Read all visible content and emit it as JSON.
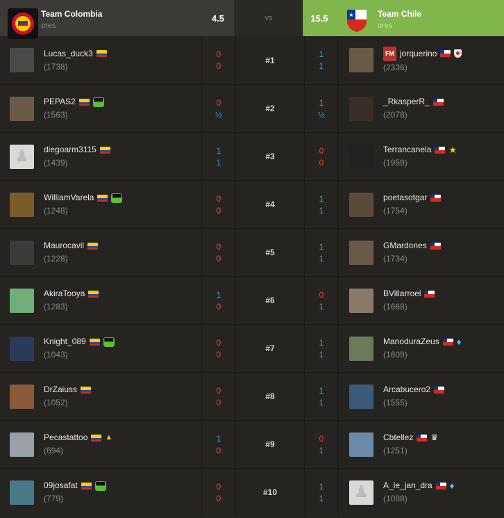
{
  "header": {
    "left_team": "Team Colombia",
    "left_sub": "ores",
    "left_score": "4.5",
    "vs_label": "vs",
    "right_score": "15.5",
    "right_team": "Team Chile",
    "right_sub": "ores"
  },
  "colors": {
    "background": "#262421",
    "header_dark": "#3c3a37",
    "header_win": "#81b64c",
    "score_win": "#3e9bd6",
    "score_loss": "#e0463b"
  },
  "rows": [
    {
      "board": "#1",
      "left": {
        "name": "Lucas_duck3",
        "rating": "(1738)",
        "badges": []
      },
      "ls": [
        "0",
        "0"
      ],
      "rs": [
        "1",
        "1"
      ],
      "right": {
        "name": "jorquerino",
        "rating": "(2336)",
        "title": "FM",
        "badges": [
          "shield-icon"
        ]
      }
    },
    {
      "board": "#2",
      "left": {
        "name": "PEPAS2",
        "rating": "(1563)",
        "badges": [
          "glasses-icon"
        ]
      },
      "ls": [
        "0",
        "½"
      ],
      "rs": [
        "1",
        "½"
      ],
      "right": {
        "name": "_RkasperR_",
        "rating": "(2078)",
        "badges": []
      }
    },
    {
      "board": "#3",
      "left": {
        "name": "diegoarm3115",
        "rating": "(1439)",
        "badges": []
      },
      "ls": [
        "1",
        "1"
      ],
      "rs": [
        "0",
        "0"
      ],
      "right": {
        "name": "Terrancanela",
        "rating": "(1959)",
        "badges": [
          "star-icon"
        ]
      }
    },
    {
      "board": "#4",
      "left": {
        "name": "WilliamVarela",
        "rating": "(1248)",
        "badges": [
          "glasses-icon"
        ]
      },
      "ls": [
        "0",
        "0"
      ],
      "rs": [
        "1",
        "1"
      ],
      "right": {
        "name": "poetasotgar",
        "rating": "(1754)",
        "badges": []
      }
    },
    {
      "board": "#5",
      "left": {
        "name": "Maurocavil",
        "rating": "(1228)",
        "badges": []
      },
      "ls": [
        "0",
        "0"
      ],
      "rs": [
        "1",
        "1"
      ],
      "right": {
        "name": "GMardones",
        "rating": "(1734)",
        "badges": []
      }
    },
    {
      "board": "#6",
      "left": {
        "name": "AkiraTooya",
        "rating": "(1283)",
        "badges": []
      },
      "ls": [
        "1",
        "0"
      ],
      "rs": [
        "0",
        "1"
      ],
      "right": {
        "name": "BVillarroel",
        "rating": "(1668)",
        "badges": []
      }
    },
    {
      "board": "#7",
      "left": {
        "name": "Knight_089",
        "rating": "(1043)",
        "badges": [
          "glasses-icon"
        ]
      },
      "ls": [
        "0",
        "0"
      ],
      "rs": [
        "1",
        "1"
      ],
      "right": {
        "name": "ManoduraZeus",
        "rating": "(1609)",
        "badges": [
          "diamond-icon"
        ]
      }
    },
    {
      "board": "#8",
      "left": {
        "name": "DrZaiuss",
        "rating": "(1052)",
        "badges": []
      },
      "ls": [
        "0",
        "0"
      ],
      "rs": [
        "1",
        "1"
      ],
      "right": {
        "name": "Arcabucero2",
        "rating": "(1555)",
        "badges": []
      }
    },
    {
      "board": "#9",
      "left": {
        "name": "Pecastattoo",
        "rating": "(694)",
        "badges": [
          "flame-icon"
        ]
      },
      "ls": [
        "1",
        "0"
      ],
      "rs": [
        "0",
        "1"
      ],
      "right": {
        "name": "Cbtellez",
        "rating": "(1251)",
        "badges": [
          "crown-icon"
        ]
      }
    },
    {
      "board": "#10",
      "left": {
        "name": "09josafat",
        "rating": "(779)",
        "badges": [
          "glasses-icon"
        ]
      },
      "ls": [
        "0",
        "0"
      ],
      "rs": [
        "1",
        "1"
      ],
      "right": {
        "name": "A_le_jan_dra",
        "rating": "(1088)",
        "badges": [
          "diamond-icon"
        ]
      }
    }
  ]
}
